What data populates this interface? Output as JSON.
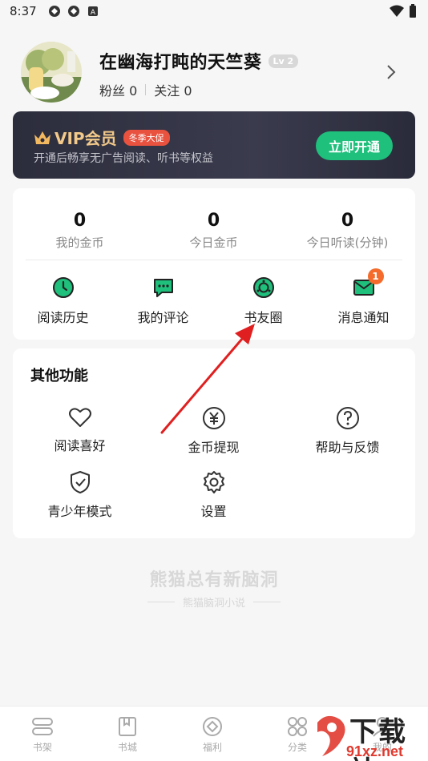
{
  "status_bar": {
    "time": "8:37"
  },
  "profile": {
    "username": "在幽海打盹的天竺葵",
    "level": "Lv 2",
    "fans_label": "粉丝",
    "fans_count": "0",
    "follow_label": "关注",
    "follow_count": "0"
  },
  "vip": {
    "title": "VIP会员",
    "promo": "冬季大促",
    "description": "开通后畅享无广告阅读、听书等权益",
    "button": "立即开通"
  },
  "stats": [
    {
      "value": "0",
      "label": "我的金币"
    },
    {
      "value": "0",
      "label": "今日金币"
    },
    {
      "value": "0",
      "label": "今日听读(分钟)"
    }
  ],
  "quick_actions": [
    {
      "label": "阅读历史",
      "icon": "clock-icon"
    },
    {
      "label": "我的评论",
      "icon": "comment-icon"
    },
    {
      "label": "书友圈",
      "icon": "circle-icon"
    },
    {
      "label": "消息通知",
      "icon": "mail-icon",
      "badge": "1"
    }
  ],
  "other": {
    "title": "其他功能",
    "items": [
      {
        "label": "阅读喜好",
        "icon": "heart-icon"
      },
      {
        "label": "金币提现",
        "icon": "yen-coin-icon"
      },
      {
        "label": "帮助与反馈",
        "icon": "help-icon"
      },
      {
        "label": "青少年模式",
        "icon": "shield-check-icon"
      },
      {
        "label": "设置",
        "icon": "gear-icon"
      }
    ]
  },
  "slogan": {
    "main": "熊猫总有新脑洞",
    "sub": "熊猫脑洞小说"
  },
  "bottom_nav": [
    {
      "label": "书架",
      "icon": "bookshelf-icon"
    },
    {
      "label": "书城",
      "icon": "bookstore-icon"
    },
    {
      "label": "福利",
      "icon": "welfare-icon"
    },
    {
      "label": "分类",
      "icon": "category-icon"
    },
    {
      "label": "我的",
      "icon": "profile-icon"
    }
  ],
  "watermark": {
    "line1": "下载站",
    "line2": "91xz.net"
  },
  "colors": {
    "accent": "#1fbf7c",
    "vip_gold": "#f2c98a",
    "promo_red": "#e8523f",
    "badge_orange": "#f46b2b",
    "arrow_red": "#e02020"
  }
}
